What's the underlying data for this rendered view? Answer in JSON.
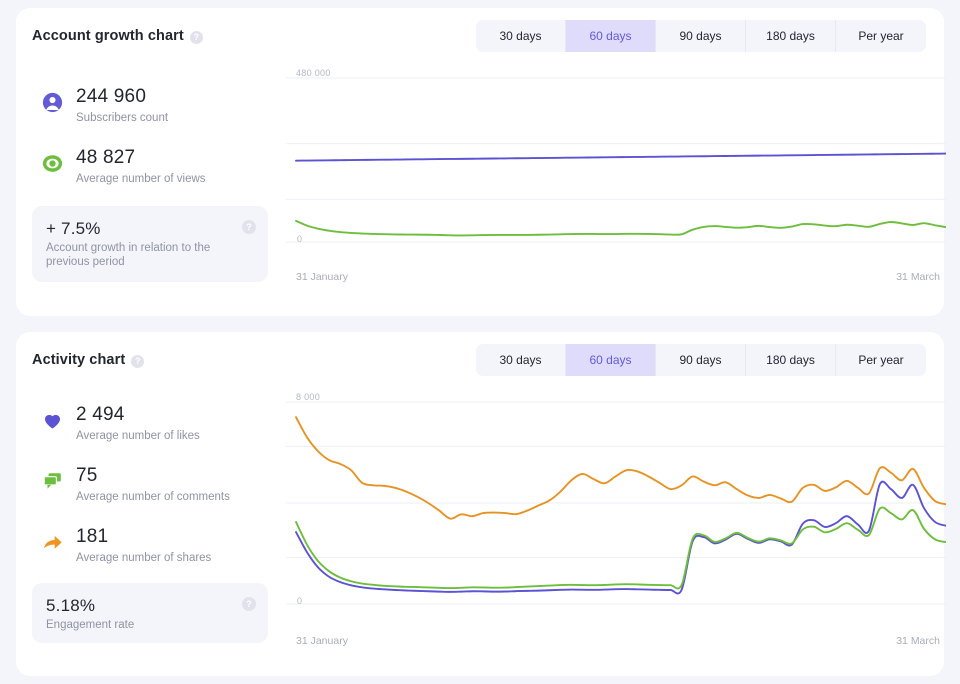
{
  "accent": {
    "purple": "#635bd6",
    "purple_line": "#5b52d4",
    "green": "#6dbe3c",
    "orange": "#e79323",
    "tab_active_bg": "#dedbfb",
    "panel_bg": "#f4f5fb",
    "muted_text": "#8f93a3"
  },
  "cards": [
    {
      "title": "Account growth chart",
      "help_icon": "help-icon",
      "tabs": [
        {
          "label": "30 days",
          "active": false
        },
        {
          "label": "60 days",
          "active": true
        },
        {
          "label": "90 days",
          "active": false
        },
        {
          "label": "180 days",
          "active": false
        },
        {
          "label": "Per year",
          "active": false
        }
      ],
      "stats": [
        {
          "icon": "user-icon",
          "value": "244 960",
          "label": "Subscribers count"
        },
        {
          "icon": "eye-icon",
          "value": "48 827",
          "label": "Average number of views"
        }
      ],
      "highlight": {
        "value": "+ 7.5%",
        "label": "Account growth in relation to the previous period",
        "help_icon": "help-icon"
      },
      "chart": {
        "y_top_label": "480 000",
        "y_bottom_label": "0",
        "date_start": "31 January",
        "date_end": "31 March"
      }
    },
    {
      "title": "Activity chart",
      "help_icon": "help-icon",
      "tabs": [
        {
          "label": "30 days",
          "active": false
        },
        {
          "label": "60 days",
          "active": true
        },
        {
          "label": "90 days",
          "active": false
        },
        {
          "label": "180 days",
          "active": false
        },
        {
          "label": "Per year",
          "active": false
        }
      ],
      "stats": [
        {
          "icon": "heart-icon",
          "value": "2 494",
          "label": "Average number of likes"
        },
        {
          "icon": "comment-icon",
          "value": "75",
          "label": "Average number of comments"
        },
        {
          "icon": "share-icon",
          "value": "181",
          "label": "Average number of shares"
        }
      ],
      "highlight": {
        "value": "5.18%",
        "label": "Engagement rate",
        "help_icon": "help-icon"
      },
      "chart": {
        "y_top_label": "8 000",
        "y_bottom_label": "0",
        "date_start": "31 January",
        "date_end": "31 March"
      }
    }
  ],
  "chart_data": [
    {
      "type": "line",
      "title": "Account growth chart",
      "xlabel": "",
      "ylabel": "",
      "ylim": [
        0,
        480000
      ],
      "grid": true,
      "legend": "none",
      "x_tick_labels": [
        "31 January",
        "31 March"
      ],
      "y_tick_labels": [
        "0",
        "480 000"
      ],
      "series": [
        {
          "name": "Subscribers count",
          "color": "#5b52d4",
          "values": [
            238000,
            238400,
            238800,
            239100,
            239500,
            239800,
            240200,
            240500,
            240900,
            241200,
            241600,
            241900,
            242300,
            242600,
            243000,
            243300,
            243700,
            244000,
            244400,
            244700,
            245100,
            245400,
            245800,
            246100,
            246500,
            246800,
            247200,
            247500,
            247900,
            248200,
            248600,
            248900,
            249300,
            249600,
            250000,
            250300,
            250700,
            251000,
            251400,
            251700,
            252100,
            252400,
            252800,
            253100,
            253500,
            253800,
            254200,
            254500,
            254900,
            255200,
            255600,
            255900,
            256300,
            256600,
            257000,
            257300,
            257700,
            258000,
            258400,
            258800
          ]
        },
        {
          "name": "Average number of views",
          "color": "#6dbe3c",
          "values": [
            62000,
            48000,
            39000,
            33000,
            29000,
            26500,
            24800,
            23600,
            22800,
            22200,
            21800,
            21600,
            21200,
            20500,
            19600,
            19200,
            19500,
            20200,
            20600,
            20700,
            20600,
            20800,
            21200,
            21800,
            22500,
            23200,
            23600,
            23500,
            23200,
            23300,
            23900,
            24100,
            23600,
            22800,
            21800,
            22600,
            36000,
            44000,
            46500,
            44200,
            41800,
            43500,
            47200,
            43800,
            41500,
            45200,
            52500,
            51800,
            48200,
            46200,
            50500,
            47800,
            44500,
            52800,
            58500,
            54500,
            49800,
            55200,
            49000,
            43500
          ]
        }
      ]
    },
    {
      "type": "line",
      "title": "Activity chart",
      "xlabel": "",
      "ylabel": "",
      "ylim": [
        0,
        8000
      ],
      "grid": true,
      "legend": "none",
      "x_tick_labels": [
        "31 January",
        "31 March"
      ],
      "y_tick_labels": [
        "0",
        "8 000"
      ],
      "series": [
        {
          "name": "Average number of likes",
          "color": "#5b52d4",
          "values": [
            2850,
            2050,
            1450,
            1080,
            870,
            740,
            660,
            610,
            580,
            555,
            535,
            520,
            505,
            490,
            480,
            490,
            505,
            500,
            490,
            495,
            510,
            520,
            530,
            545,
            560,
            570,
            565,
            560,
            570,
            585,
            590,
            580,
            570,
            560,
            555,
            560,
            2480,
            2650,
            2400,
            2550,
            2780,
            2580,
            2420,
            2560,
            2480,
            2350,
            3180,
            3320,
            3050,
            3200,
            3480,
            3150,
            2900,
            4750,
            4550,
            4200,
            4720,
            3800,
            3250,
            3100
          ]
        },
        {
          "name": "Average number of comments",
          "color": "#6dbe3c",
          "values": [
            3250,
            2350,
            1700,
            1300,
            1050,
            900,
            810,
            760,
            720,
            700,
            680,
            670,
            655,
            640,
            630,
            640,
            660,
            655,
            645,
            650,
            670,
            690,
            710,
            730,
            750,
            760,
            750,
            745,
            755,
            775,
            785,
            775,
            760,
            750,
            745,
            750,
            2580,
            2720,
            2460,
            2600,
            2820,
            2620,
            2470,
            2600,
            2520,
            2400,
            2950,
            3060,
            2840,
            2970,
            3200,
            2940,
            2730,
            3780,
            3600,
            3350,
            3720,
            2980,
            2560,
            2450
          ]
        },
        {
          "name": "Average number of shares",
          "color": "#e79323",
          "values": [
            7400,
            6600,
            6050,
            5700,
            5550,
            5300,
            4800,
            4700,
            4680,
            4600,
            4450,
            4250,
            4000,
            3700,
            3380,
            3550,
            3480,
            3600,
            3620,
            3600,
            3560,
            3700,
            3900,
            4100,
            4450,
            4900,
            5150,
            4950,
            4780,
            5050,
            5300,
            5250,
            5050,
            4800,
            4550,
            4700,
            5050,
            4850,
            4700,
            4820,
            4550,
            4300,
            4200,
            4320,
            4180,
            4050,
            4600,
            4720,
            4480,
            4620,
            4880,
            4600,
            4380,
            5380,
            5200,
            4900,
            5350,
            4600,
            4080,
            3950
          ]
        }
      ]
    }
  ]
}
